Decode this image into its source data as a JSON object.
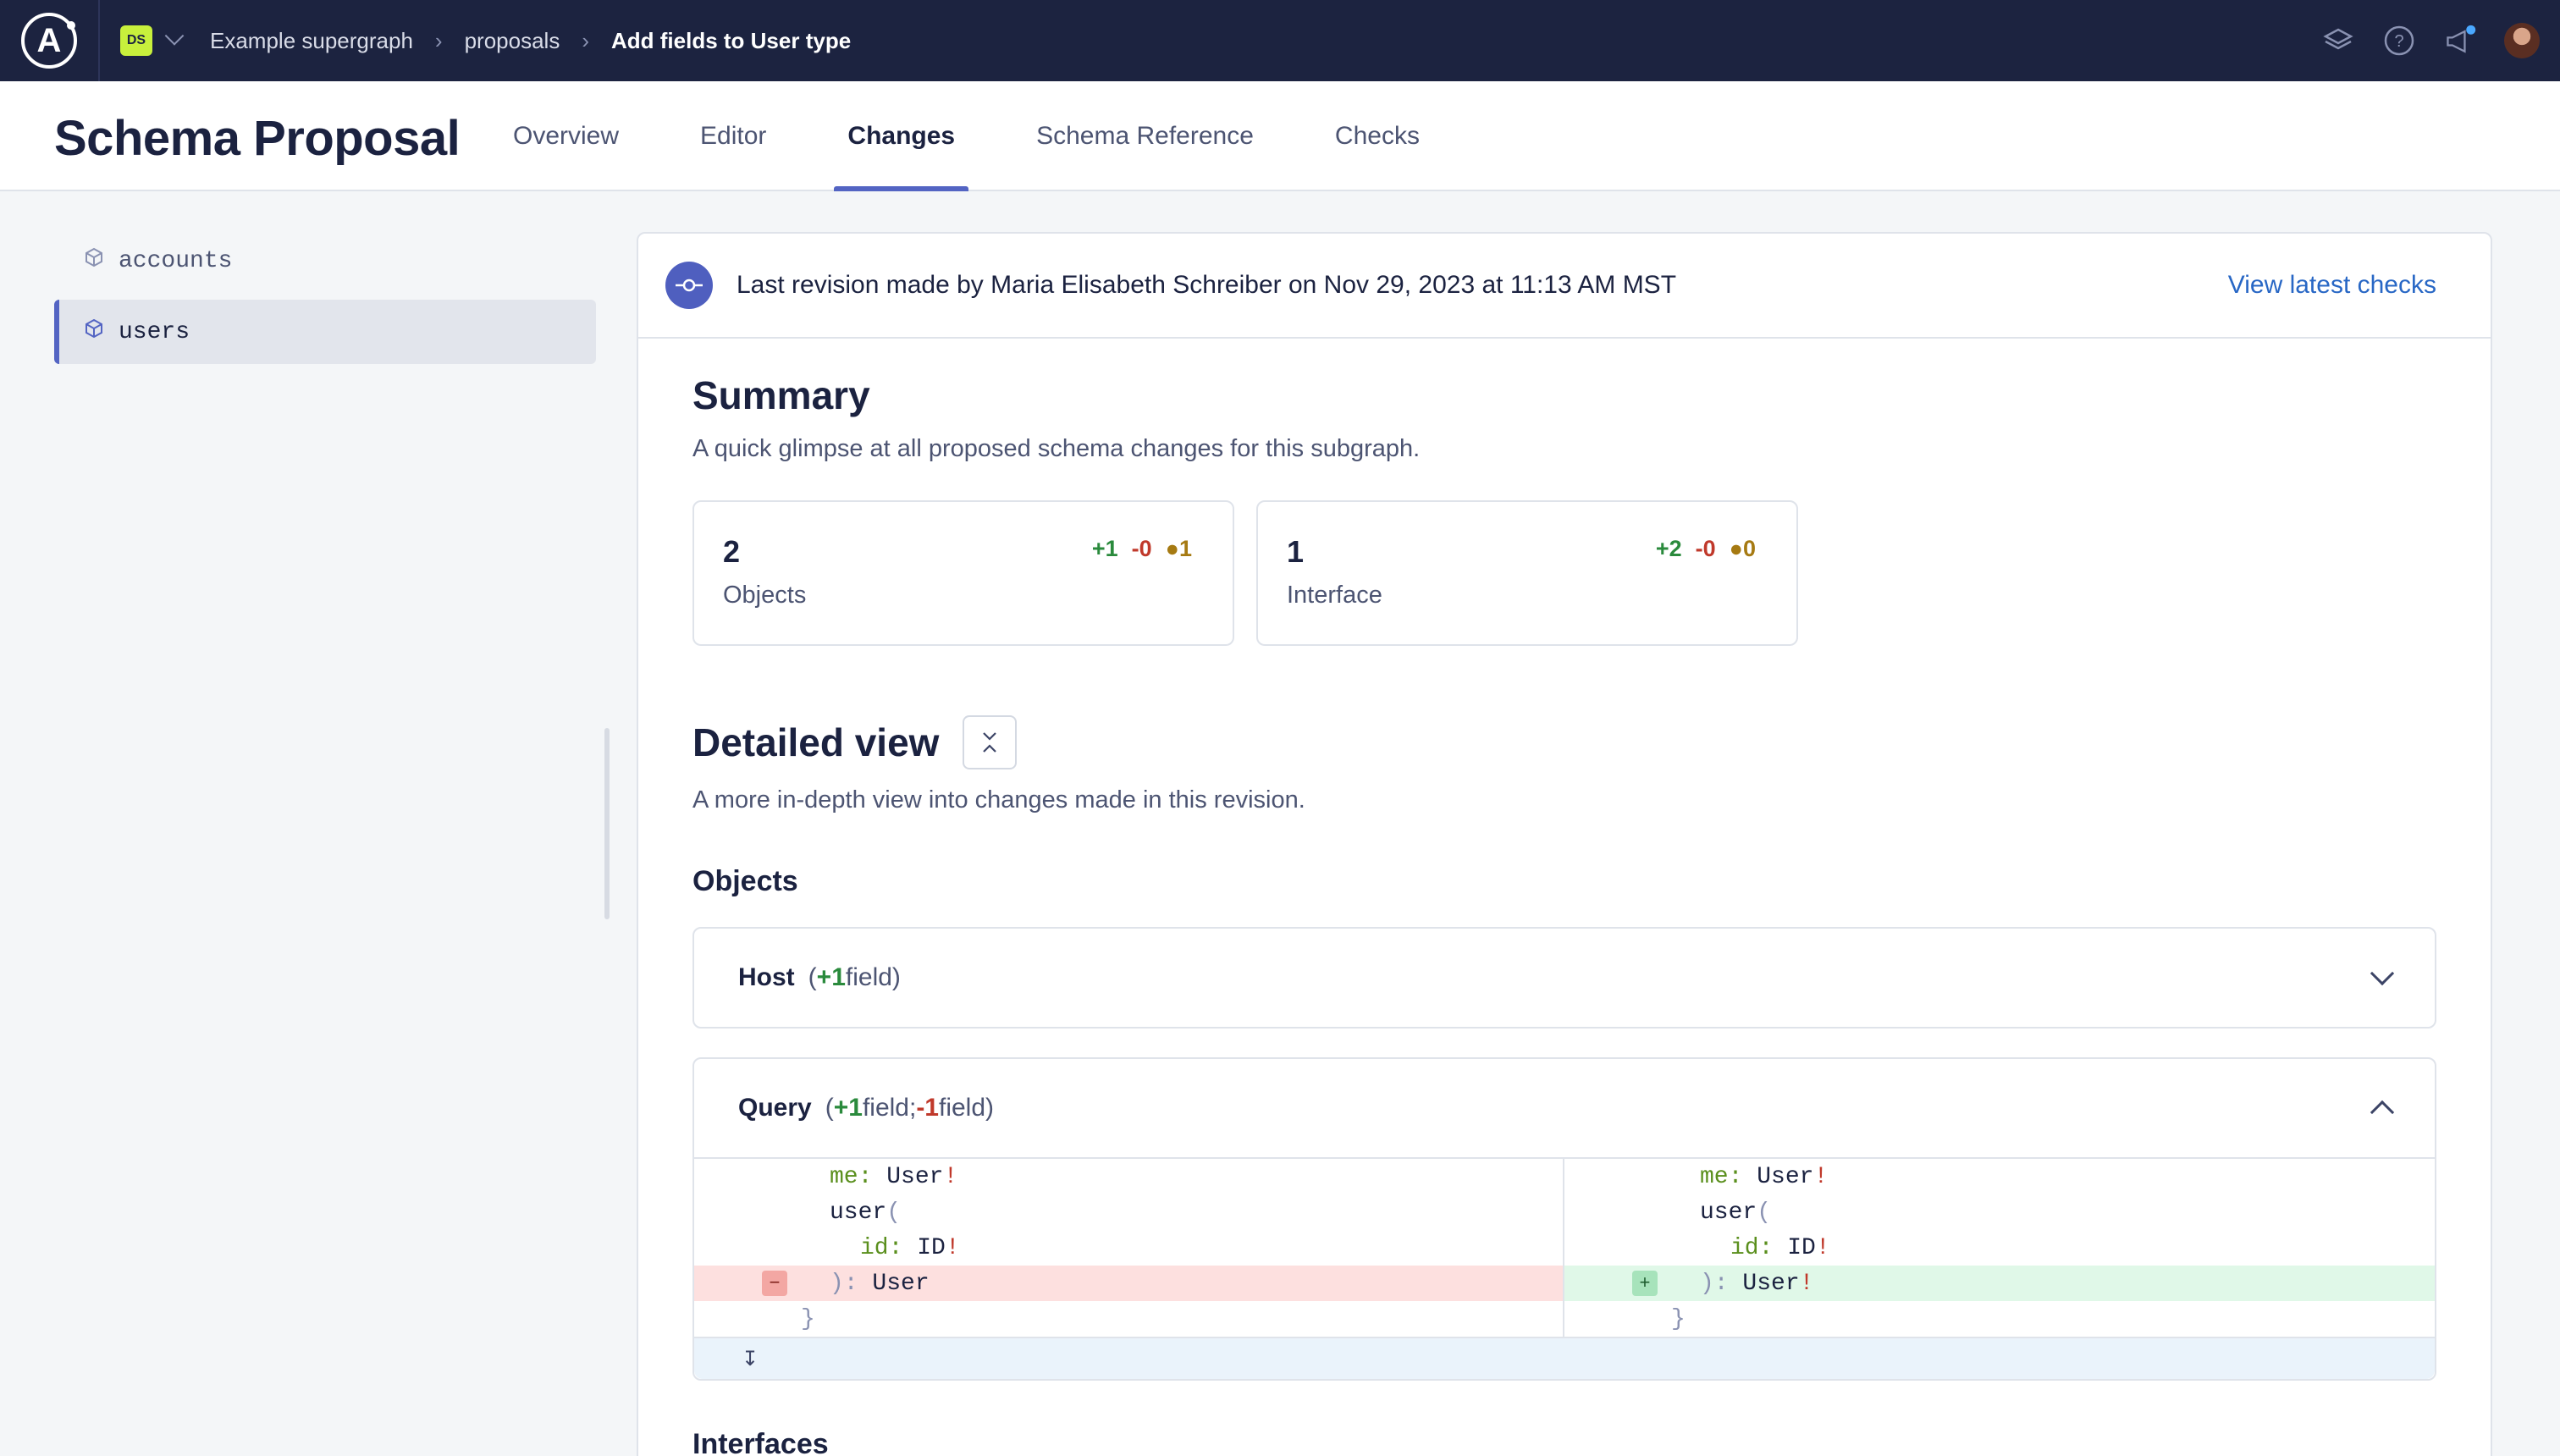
{
  "topbar": {
    "org_badge": "DS",
    "breadcrumbs": [
      {
        "label": "Example supergraph"
      },
      {
        "label": "proposals"
      },
      {
        "label": "Add fields to User type"
      }
    ],
    "icons": [
      "graph-stack-icon",
      "help-icon",
      "announcements-icon",
      "user-avatar"
    ]
  },
  "header": {
    "title": "Schema Proposal",
    "tabs": [
      {
        "label": "Overview",
        "active": false
      },
      {
        "label": "Editor",
        "active": false
      },
      {
        "label": "Changes",
        "active": true
      },
      {
        "label": "Schema Reference",
        "active": false
      },
      {
        "label": "Checks",
        "active": false
      }
    ]
  },
  "sidebar": {
    "items": [
      {
        "label": "accounts",
        "active": false
      },
      {
        "label": "users",
        "active": true
      }
    ]
  },
  "revision": {
    "text": "Last revision made by Maria Elisabeth Schreiber on Nov 29, 2023 at 11:13 AM MST",
    "link": "View latest checks"
  },
  "summary": {
    "title": "Summary",
    "subtitle": "A quick glimpse at all proposed schema changes for this subgraph.",
    "stats": [
      {
        "count": "2",
        "label": "Objects",
        "added": "+1",
        "removed": "-0",
        "modified": "●1"
      },
      {
        "count": "1",
        "label": "Interface",
        "added": "+2",
        "removed": "-0",
        "modified": "●0"
      }
    ]
  },
  "detailed": {
    "title": "Detailed view",
    "subtitle": "A more in-depth view into changes made in this revision.",
    "objects_heading": "Objects",
    "objects": [
      {
        "name": "Host",
        "summary_open": "(",
        "plus": "+1",
        "summary_mid": " field)",
        "expanded": false
      },
      {
        "name": "Query",
        "summary_open": "(",
        "plus": "+1",
        "summary_mid": " field; ",
        "minus": "-1",
        "summary_end": " field)",
        "expanded": true,
        "diff": {
          "left": {
            "l1_key": "me:",
            "l1_type": " User",
            "l1_bang": "!",
            "l2": "user",
            "l2_paren": "(",
            "l3_key": "id:",
            "l3_type": " ID",
            "l3_bang": "!",
            "l4_paren": "):",
            "l4_type": " User",
            "l5": "}",
            "marker": "−"
          },
          "right": {
            "l1_key": "me:",
            "l1_type": " User",
            "l1_bang": "!",
            "l2": "user",
            "l2_paren": "(",
            "l3_key": "id:",
            "l3_type": " ID",
            "l3_bang": "!",
            "l4_paren": "):",
            "l4_type": " User",
            "l4_bang": "!",
            "l5": "}",
            "marker": "+"
          }
        },
        "expand_glyph": "↧"
      }
    ],
    "interfaces_heading": "Interfaces"
  }
}
